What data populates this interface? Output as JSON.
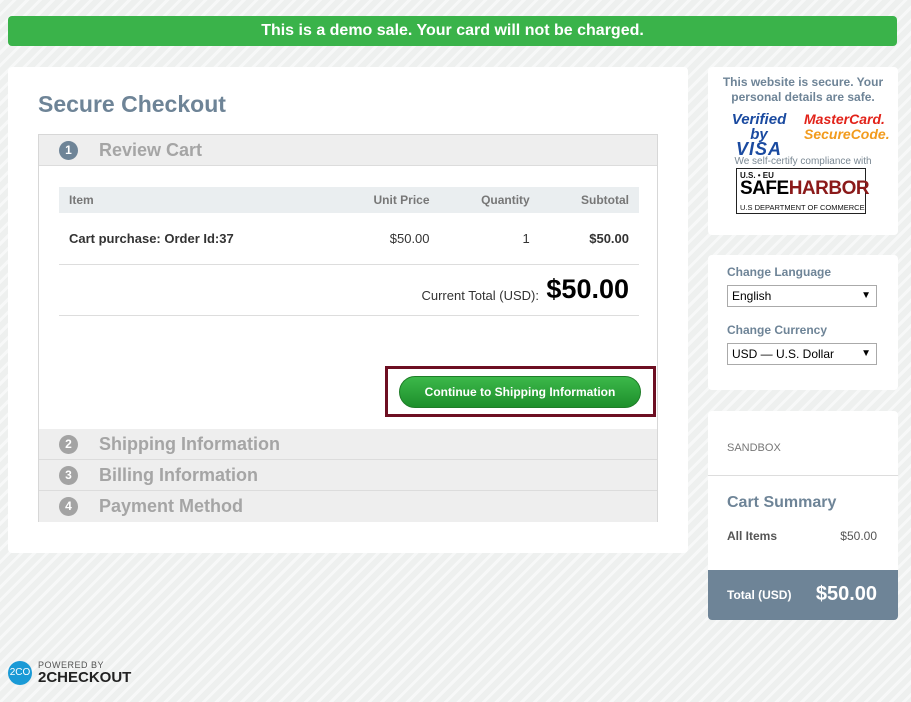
{
  "banner": {
    "text": "This is a demo sale. Your card will not be charged."
  },
  "checkout": {
    "title": "Secure Checkout",
    "steps": [
      {
        "number": "1",
        "label": "Review Cart"
      },
      {
        "number": "2",
        "label": "Shipping Information"
      },
      {
        "number": "3",
        "label": "Billing Information"
      },
      {
        "number": "4",
        "label": "Payment Method"
      }
    ],
    "table": {
      "headers": {
        "item": "Item",
        "unit_price": "Unit Price",
        "quantity": "Quantity",
        "subtotal": "Subtotal"
      },
      "rows": [
        {
          "item": "Cart purchase: Order Id:37",
          "unit_price": "$50.00",
          "quantity": "1",
          "subtotal": "$50.00"
        }
      ]
    },
    "current_total_label": "Current Total (USD):",
    "current_total_value": "$50.00",
    "continue_button": "Continue to Shipping Information"
  },
  "security": {
    "text": "This website is secure. Your personal details are safe.",
    "verified_visa_top": "Verified by",
    "verified_visa_bottom": "VISA",
    "mastercard_top": "MasterCard.",
    "mastercard_bottom": "SecureCode.",
    "selfcert": "We self-certify compliance with",
    "safeharbor_top": "U.S. • EU",
    "safeharbor_safe": "SAFE",
    "safeharbor_harbor": "HARBOR",
    "safeharbor_bottom": "U.S DEPARTMENT OF COMMERCE"
  },
  "settings": {
    "language_label": "Change Language",
    "language_value": "English",
    "currency_label": "Change Currency",
    "currency_value": "USD — U.S. Dollar"
  },
  "summary": {
    "sandbox": "SANDBOX",
    "title": "Cart Summary",
    "items_label": "All Items",
    "items_value": "$50.00",
    "total_label": "Total (USD)",
    "total_value": "$50.00"
  },
  "footer": {
    "logo_mark": "2CO",
    "powered": "POWERED BY",
    "brand": "2CHECKOUT"
  },
  "colors": {
    "banner": "#3ab34a",
    "accent": "#6e8497",
    "button": "#2aa53a",
    "highlight": "#6d0f22"
  }
}
